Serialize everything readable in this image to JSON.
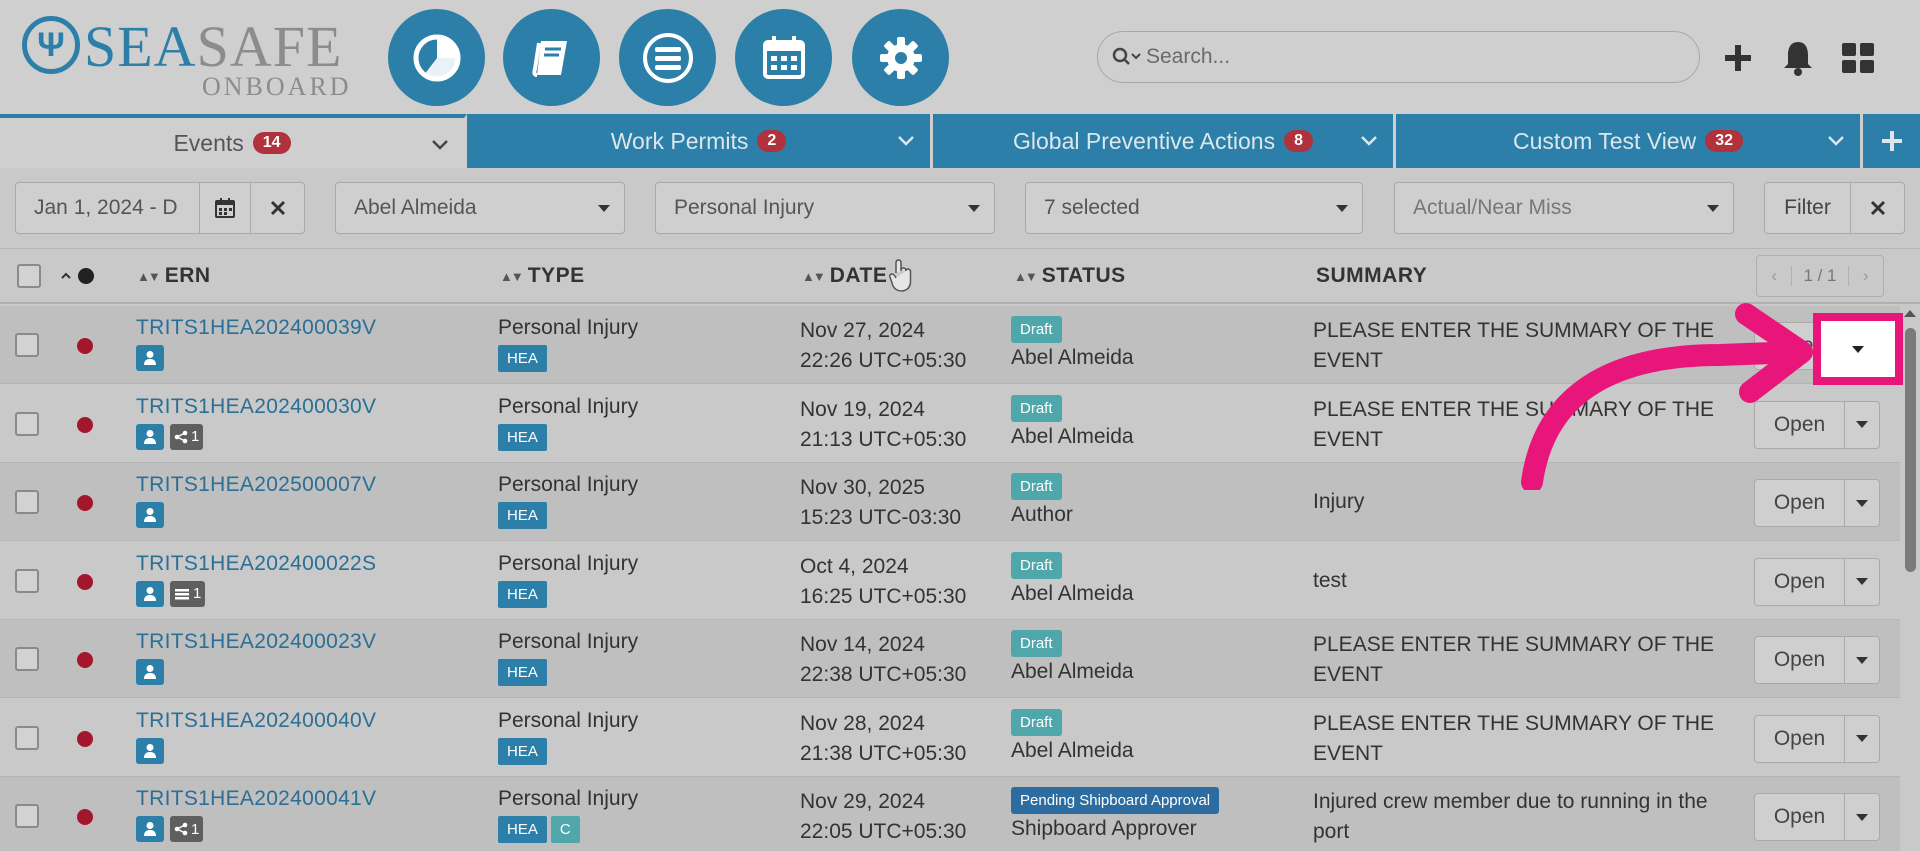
{
  "logo": {
    "sea": "SEA",
    "safe": "SAFE",
    "sub": "ONBOARD"
  },
  "nav": [
    {
      "name": "dashboard",
      "icon": "pie-chart-icon"
    },
    {
      "name": "book",
      "icon": "book-icon"
    },
    {
      "name": "menu",
      "icon": "list-icon"
    },
    {
      "name": "calendar",
      "icon": "calendar-icon"
    },
    {
      "name": "settings",
      "icon": "gear-icon"
    }
  ],
  "search": {
    "placeholder": "Search..."
  },
  "tabs": [
    {
      "label": "Events",
      "count": "14"
    },
    {
      "label": "Work Permits",
      "count": "2"
    },
    {
      "label": "Global Preventive Actions",
      "count": "8"
    },
    {
      "label": "Custom Test View",
      "count": "32"
    }
  ],
  "filters": {
    "date_range": "Jan 1, 2024 - D",
    "person": "Abel Almeida",
    "type": "Personal Injury",
    "statuses": "7 selected",
    "actual_near_miss_placeholder": "Actual/Near Miss",
    "filter_label": "Filter"
  },
  "table": {
    "columns": {
      "ern": "ERN",
      "type": "TYPE",
      "date": "DATE",
      "status": "STATUS",
      "summary": "SUMMARY"
    },
    "pager": {
      "prev": "‹",
      "page": "1 / 1",
      "next": "›"
    },
    "open_label": "Open",
    "rows": [
      {
        "ern": "TRITS1HEA202400039V",
        "badges": [],
        "type": "Personal Injury",
        "tags": [
          "HEA"
        ],
        "date": "Nov 27, 2024",
        "time": "22:26 UTC+05:30",
        "status": "Draft",
        "owner": "Abel Almeida",
        "summary": "PLEASE ENTER THE SUMMARY OF THE EVENT"
      },
      {
        "ern": "TRITS1HEA202400030V",
        "badges": [
          {
            "icon": "share-icon",
            "count": "1"
          }
        ],
        "type": "Personal Injury",
        "tags": [
          "HEA"
        ],
        "date": "Nov 19, 2024",
        "time": "21:13 UTC+05:30",
        "status": "Draft",
        "owner": "Abel Almeida",
        "summary": "PLEASE ENTER THE SUMMARY OF THE EVENT"
      },
      {
        "ern": "TRITS1HEA202500007V",
        "badges": [],
        "type": "Personal Injury",
        "tags": [
          "HEA"
        ],
        "date": "Nov 30, 2025",
        "time": "15:23 UTC-03:30",
        "status": "Draft",
        "owner": "Author",
        "summary": "Injury"
      },
      {
        "ern": "TRITS1HEA202400022S",
        "badges": [
          {
            "icon": "list-icon",
            "count": "1"
          }
        ],
        "type": "Personal Injury",
        "tags": [
          "HEA"
        ],
        "date": "Oct 4, 2024",
        "time": "16:25 UTC+05:30",
        "status": "Draft",
        "owner": "Abel Almeida",
        "summary": "test"
      },
      {
        "ern": "TRITS1HEA202400023V",
        "badges": [],
        "type": "Personal Injury",
        "tags": [
          "HEA"
        ],
        "date": "Nov 14, 2024",
        "time": "22:38 UTC+05:30",
        "status": "Draft",
        "owner": "Abel Almeida",
        "summary": "PLEASE ENTER THE SUMMARY OF THE EVENT"
      },
      {
        "ern": "TRITS1HEA202400040V",
        "badges": [],
        "type": "Personal Injury",
        "tags": [
          "HEA"
        ],
        "date": "Nov 28, 2024",
        "time": "21:38 UTC+05:30",
        "status": "Draft",
        "owner": "Abel Almeida",
        "summary": "PLEASE ENTER THE SUMMARY OF THE EVENT"
      },
      {
        "ern": "TRITS1HEA202400041V",
        "badges": [
          {
            "icon": "share-icon",
            "count": "1"
          }
        ],
        "type": "Personal Injury",
        "tags": [
          "HEA",
          "C"
        ],
        "date": "Nov 29, 2024",
        "time": "22:05 UTC+05:30",
        "status": "Pending Shipboard Approval",
        "owner": "Shipboard Approver",
        "summary": "Injured crew member due to running in the port"
      }
    ]
  },
  "colors": {
    "brand": "#2c7fa8",
    "badge": "#b0323c",
    "draft": "#4fa6ab",
    "pending": "#2c6ca0",
    "highlight": "#e8167a",
    "dot": "#a3162c"
  }
}
